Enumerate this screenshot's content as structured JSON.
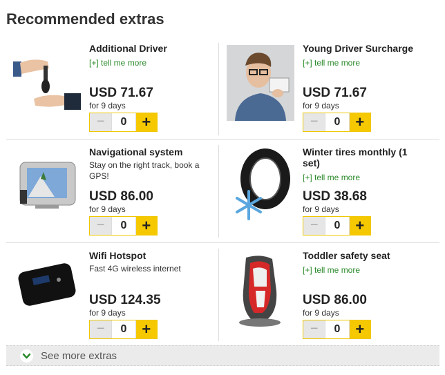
{
  "heading": "Recommended extras",
  "see_more": "See more extras",
  "items": [
    {
      "name": "Additional Driver",
      "desc": "",
      "more": "[+] tell me more",
      "price": "USD 71.67",
      "per": "for 9 days",
      "minus": "−",
      "qty": "0",
      "plus": "+",
      "image": "car-keys-handover"
    },
    {
      "name": "Young Driver Surcharge",
      "desc": "",
      "more": "[+] tell me more",
      "price": "USD 71.67",
      "per": "for 9 days",
      "minus": "−",
      "qty": "0",
      "plus": "+",
      "image": "young-man-with-card"
    },
    {
      "name": "Navigational system",
      "desc": "Stay on the right track, book a GPS!",
      "more": "",
      "price": "USD 86.00",
      "per": "for 9 days",
      "minus": "−",
      "qty": "0",
      "plus": "+",
      "image": "gps-device"
    },
    {
      "name": "Winter tires monthly (1 set)",
      "desc": "",
      "more": "[+] tell me more",
      "price": "USD 38.68",
      "per": "for 9 days",
      "minus": "−",
      "qty": "0",
      "plus": "+",
      "image": "tire-with-snowflake"
    },
    {
      "name": "Wifi Hotspot",
      "desc": "Fast 4G wireless internet",
      "more": "",
      "price": "USD 124.35",
      "per": "for 9 days",
      "minus": "−",
      "qty": "0",
      "plus": "+",
      "image": "wifi-hotspot-device"
    },
    {
      "name": "Toddler safety seat",
      "desc": "",
      "more": "[+] tell me more",
      "price": "USD 86.00",
      "per": "for 9 days",
      "minus": "−",
      "qty": "0",
      "plus": "+",
      "image": "child-car-seat"
    }
  ],
  "colors": {
    "accent": "#f5c800",
    "link": "#2a8a2a",
    "see_more_bg": "#ebebeb"
  }
}
